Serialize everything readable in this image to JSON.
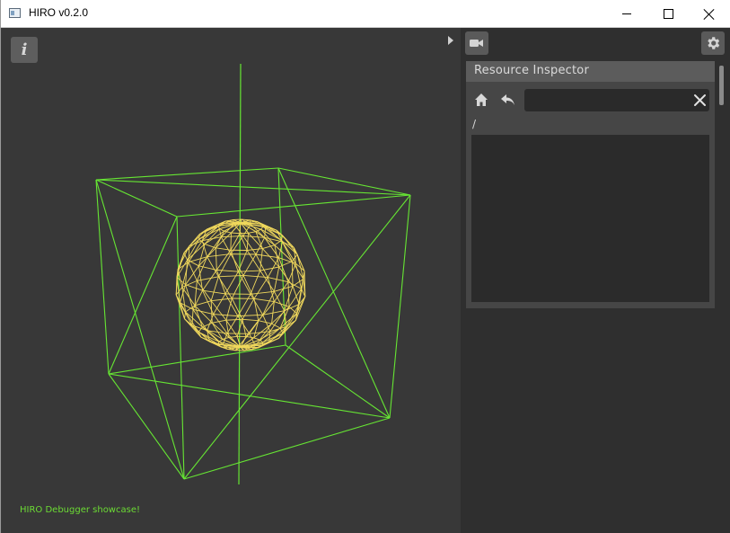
{
  "window": {
    "title": "HIRO v0.2.0",
    "controls": {
      "minimize_icon": "minimize-icon",
      "maximize_icon": "maximize-icon",
      "close_icon": "close-icon"
    }
  },
  "viewport": {
    "info_icon": "info-icon",
    "info_glyph": "i",
    "caption": "HIRO Debugger showcase!",
    "collapse_icon": "triangle-right-icon",
    "colors": {
      "background": "#383838",
      "cube": "#66e633",
      "axis": "#66e633",
      "sphere": "#f0d85c",
      "caption": "#6cdc34"
    }
  },
  "sidebar": {
    "camera_icon": "video-camera-icon",
    "settings_icon": "gear-icon",
    "resource_inspector": {
      "title": "Resource Inspector",
      "home_icon": "home-icon",
      "back_icon": "undo-arrow-icon",
      "search": {
        "value": "",
        "placeholder": ""
      },
      "clear_icon": "close-icon",
      "path": "/"
    }
  }
}
